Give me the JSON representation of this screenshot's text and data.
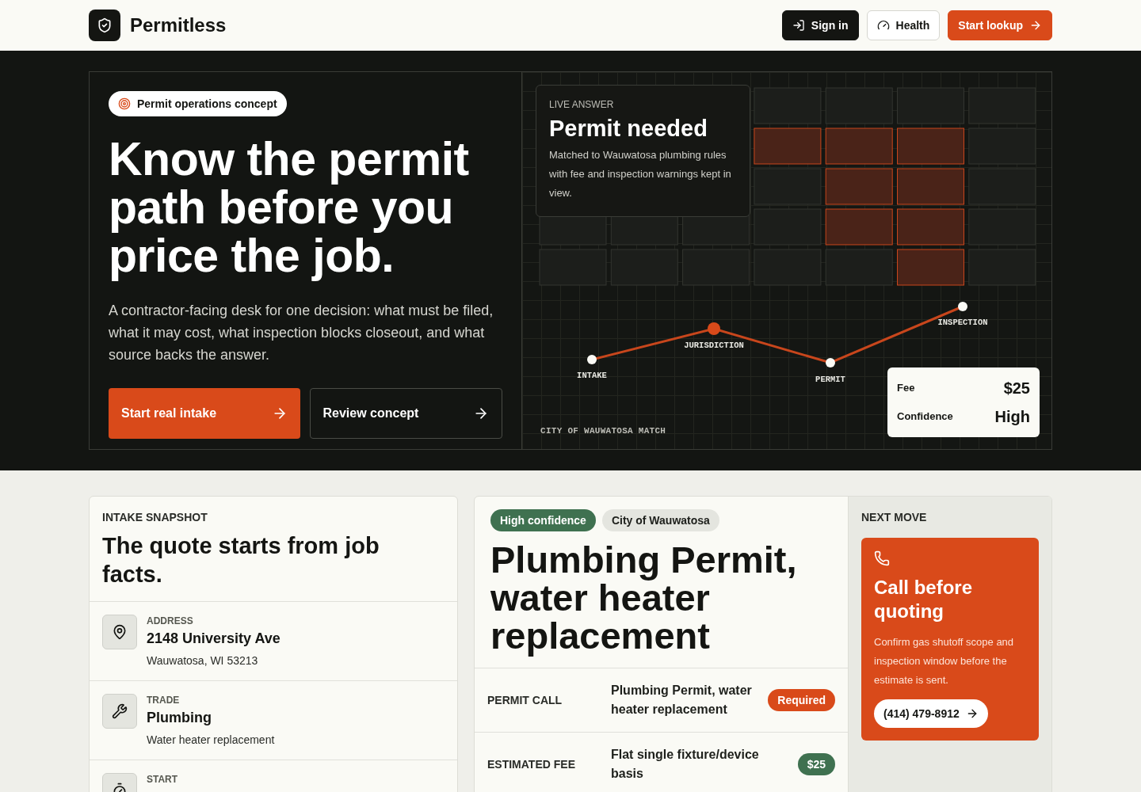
{
  "brand": {
    "name": "Permitless"
  },
  "nav": [
    {
      "kind": "dark",
      "label": "Sign in"
    },
    {
      "kind": "outline",
      "label": "Health"
    },
    {
      "kind": "accent",
      "label": "Start lookup"
    }
  ],
  "hero": {
    "badge": "Permit operations concept",
    "title": "Know the permit path before you price the job.",
    "body": "A contractor-facing desk for one decision: what must be filed, what it may cost, what inspection blocks closeout, and what source backs the answer.",
    "actions": [
      {
        "kind": "primary",
        "label": "Start real intake"
      },
      {
        "kind": "secondary",
        "label": "Review concept"
      }
    ]
  },
  "live": {
    "eyebrow": "LIVE ANSWER",
    "title": "Permit needed",
    "body": "Matched to Wauwatosa plumbing rules with fee and inspection warnings kept in view.",
    "steps": [
      {
        "label": "INTAKE",
        "selected": false
      },
      {
        "label": "JURISDICTION",
        "selected": true
      },
      {
        "label": "PERMIT",
        "selected": false
      },
      {
        "label": "INSPECTION",
        "selected": false
      }
    ],
    "caption": "CITY OF WAUWATOSA MATCH",
    "stats": [
      {
        "label": "Fee",
        "value": "$25"
      },
      {
        "label": "Confidence",
        "value": "High"
      }
    ]
  },
  "intake": {
    "eyebrow": "INTAKE SNAPSHOT",
    "title": "The quote starts from job facts.",
    "facts": [
      {
        "kind": "pin",
        "label": "ADDRESS",
        "value": "2148 University Ave",
        "detail": "Wauwatosa, WI 53213"
      },
      {
        "kind": "wrench",
        "label": "TRADE",
        "value": "Plumbing",
        "detail": "Water heater replacement"
      },
      {
        "kind": "timer",
        "label": "START"
      }
    ]
  },
  "result": {
    "tags": [
      {
        "kind": "green",
        "label": "High confidence"
      },
      {
        "kind": "gray",
        "label": "City of Wauwatosa"
      }
    ],
    "title": "Plumbing Permit, water heater replacement",
    "rows": [
      {
        "label": "PERMIT CALL",
        "value": "Plumbing Permit, water heater replacement",
        "badge": "Required",
        "kind": "orange"
      },
      {
        "label": "ESTIMATED FEE",
        "value": "Flat single fixture/device basis",
        "badge": "$25",
        "kind": "green"
      }
    ]
  },
  "next": {
    "eyebrow": "NEXT MOVE",
    "title": "Call before quoting",
    "body": "Confirm gas shutoff scope and inspection window before the estimate is sent.",
    "phone": "(414) 479-8912"
  }
}
